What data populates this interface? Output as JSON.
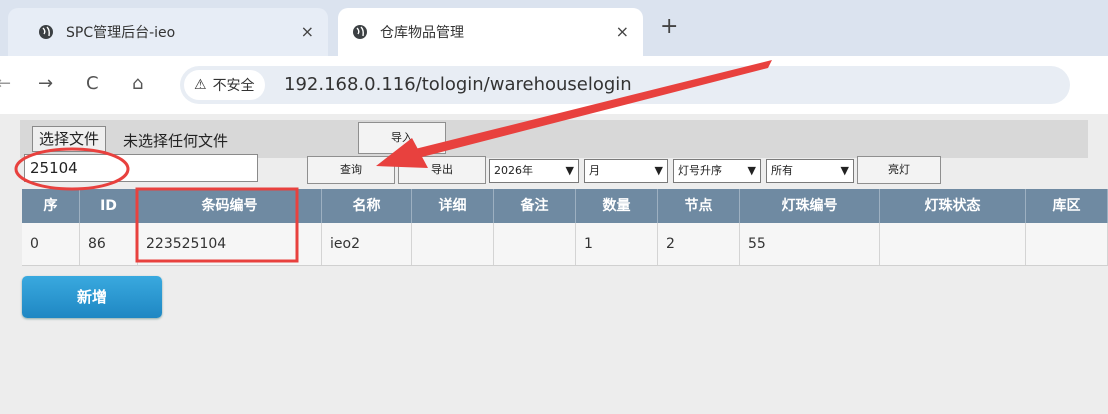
{
  "browser": {
    "tabs": [
      {
        "title": "SPC管理后台-ieo",
        "close": "×"
      },
      {
        "title": "仓库物品管理",
        "close": "×"
      }
    ],
    "new_tab": "+",
    "nav": {
      "back": "←",
      "forward": "→",
      "reload": "C",
      "home": "⌂"
    },
    "security_label": "不安全",
    "security_icon": "warning-triangle-icon",
    "url": "192.168.0.116/tologin/warehouselogin"
  },
  "toolbar": {
    "file_button": "选择文件",
    "file_status": "未选择任何文件",
    "import_button": "导入",
    "search_value": "25104",
    "query_button": "查询",
    "export_button": "导出",
    "year_select": "2026年",
    "month_select": "月",
    "sort_select": "灯号升序",
    "filter_select": "所有",
    "light_button": "亮灯"
  },
  "table": {
    "headers": [
      "序",
      "ID",
      "条码编号",
      "名称",
      "详细",
      "备注",
      "数量",
      "节点",
      "灯珠编号",
      "灯珠状态",
      "库区"
    ],
    "rows": [
      [
        "0",
        "86",
        "223525104",
        "ieo2",
        "",
        "",
        "1",
        "2",
        "55",
        "",
        ""
      ]
    ]
  },
  "add_button": "新增",
  "colors": {
    "table_header": "#6f8aa2",
    "add_button": "#2596d1",
    "annotation_red": "#e8413e"
  }
}
